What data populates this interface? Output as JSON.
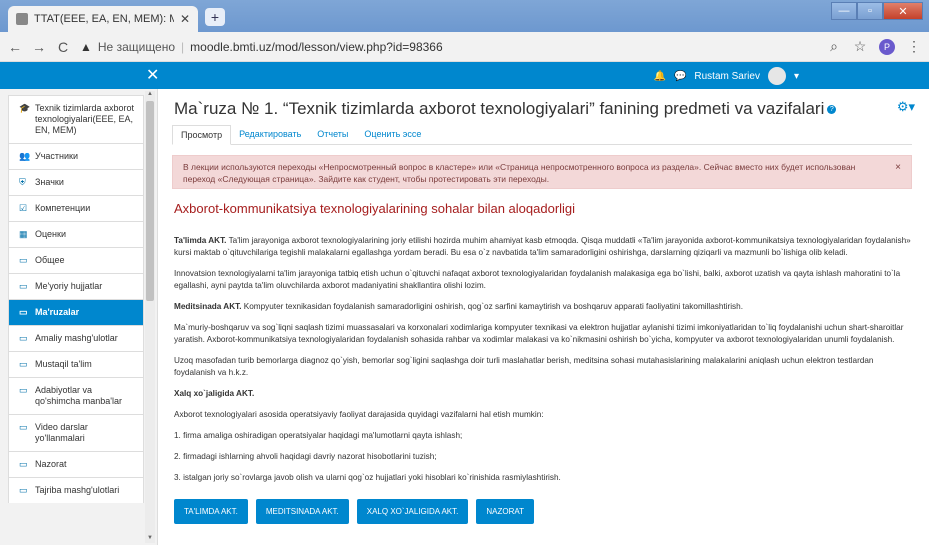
{
  "browser": {
    "tab_title": "TTAT(EEE, EA, EN, MEM): Ma'ruza",
    "tab_close": "✕",
    "new_tab": "+",
    "not_secure": "Не защищено",
    "url": "moodle.bmti.uz/mod/lesson/view.php?id=98366",
    "profile_initial": "P"
  },
  "navbar": {
    "close_symbol": "✕",
    "user_name": "Rustam Sariev"
  },
  "sidebar": {
    "items": [
      {
        "icon": "graduation-cap-icon",
        "glyph": "🎓",
        "label": "Texnik tizimlarda axborot texnologiyalari(EEE, EA, EN, MEM)"
      },
      {
        "icon": "users-icon",
        "glyph": "👥",
        "label": "Участники"
      },
      {
        "icon": "shield-icon",
        "glyph": "⛨",
        "label": "Значки"
      },
      {
        "icon": "check-icon",
        "glyph": "☑",
        "label": "Компетенции"
      },
      {
        "icon": "grid-icon",
        "glyph": "▦",
        "label": "Оценки"
      },
      {
        "icon": "folder-icon",
        "glyph": "▭",
        "label": "Общее"
      },
      {
        "icon": "folder-icon",
        "glyph": "▭",
        "label": "Me'yoriy hujjatlar"
      },
      {
        "icon": "folder-icon",
        "glyph": "▭",
        "label": "Ma'ruzalar"
      },
      {
        "icon": "folder-icon",
        "glyph": "▭",
        "label": "Amaliy mashg'ulotlar"
      },
      {
        "icon": "folder-icon",
        "glyph": "▭",
        "label": "Mustaqil ta'lim"
      },
      {
        "icon": "folder-icon",
        "glyph": "▭",
        "label": "Adabiyotlar va qo'shimcha manba'lar"
      },
      {
        "icon": "folder-icon",
        "glyph": "▭",
        "label": "Video darslar yo'llanmalari"
      },
      {
        "icon": "folder-icon",
        "glyph": "▭",
        "label": "Nazorat"
      },
      {
        "icon": "folder-icon",
        "glyph": "▭",
        "label": "Tajriba mashg'ulotlari"
      }
    ],
    "active_index": 7
  },
  "main": {
    "title": "Ma`ruza № 1. “Texnik tizimlarda axborot texnologiyalari” fanining predmeti va vazifalari",
    "tabs": [
      "Просмотр",
      "Редактировать",
      "Отчеты",
      "Оценить эссе"
    ],
    "alert": "В лекции используются переходы «Непросмотренный вопрос в кластере» или «Страница непросмотренного вопроса из раздела». Сейчас вместо них будет использован переход «Следующая страница». Зайдите как студент, чтобы протестировать эти переходы.",
    "alert_close": "×",
    "section_title": "Axborot-kommunikatsiya texnologiyalarining sohalar bilan aloqadorligi",
    "p1_bold": "Ta'limda AKT.",
    "p1": " Ta'lim jarayoniga axborot texnologiyalarining joriy etilishi hozirda muhim ahamiyat kasb etmoqda. Qisqa muddatli «Ta'lim jarayonida axborot-kommunikatsiya texnologiyalaridan foydalanish» kursi maktab o`qituvchilariga tegishli malakalarni egallashga yordam beradi. Bu esa o`z navbatida ta'lim samaradorligini oshirishga, darslarning qiziqarli va mazmunli bo`lishiga olib keladi.",
    "p2": "Innovatsion texnologiyalarni ta'lim jarayoniga tatbiq etish uchun o`qituvchi nafaqat axborot texnologiyalaridan foydalanish malakasiga ega bo`lishi, balki, axborot uzatish va qayta ishlash mahoratini to`la egallashi, ayni paytda ta'lim oluvchilarda axborot madaniyatini shakllantira olishi lozim.",
    "p3_bold": "Meditsinada AKT.",
    "p3": " Kompyuter texnikasidan foydalanish samaradorligini oshirish, qog`oz sarfini kamaytirish va boshqaruv apparati faoliyatini takomillashtirish.",
    "p4": "Ma`muriy-boshqaruv va sog`liqni saqlash tizimi muassasalari va korxonalari xodimlariga kompyuter texnikasi va elektron hujjatlar aylanishi tizimi imkoniyatlaridan to`liq foydalanishi uchun shart-sharoitlar yaratish. Axborot-kommunikatsiya texnologiyalaridan foydalanish sohasida rahbar va xodimlar malakasi va ko`nikmasini oshirish bo`yicha, kompyuter va axborot texnologiyalaridan unumli foydalanish.",
    "p5": "Uzoq masofadan turib bemorlarga diagnoz qo`yish, bemorlar sog`ligini saqlashga doir turli maslahatlar berish, meditsina sohasi mutahasislarining malakalarini aniqlash uchun elektron testlardan foydalanish va h.k.z.",
    "p6_bold": "Xalq xo`jaligida AKT.",
    "p7": "Axborot texnologiyalari asosida operatsiyaviy faoliyat darajasida quyidagi vazifalarni hal etish mumkin:",
    "p8": "1. firma amaliga oshiradigan operatsiyalar haqidagi ma'lumotlarni qayta ishlash;",
    "p9": "2. firmadagi ishlarning ahvoli haqidagi davriy nazorat hisobotlarini tuzish;",
    "p10": "3. istalgan joriy so`rovlarga javob olish va ularni qog`oz hujjatlari yoki hisoblari ko`rinishida rasmiylashtirish.",
    "buttons": [
      "TA'LIMDA AKT.",
      "MEDITSINADA AKT.",
      "XALQ XO`JALIGIDA AKT.",
      "NAZORAT"
    ]
  },
  "colors": {
    "navbar": "#0087ce",
    "active_item": "#0087ce",
    "section_title": "#a61e1e",
    "alert_bg": "#f3d8d8"
  }
}
